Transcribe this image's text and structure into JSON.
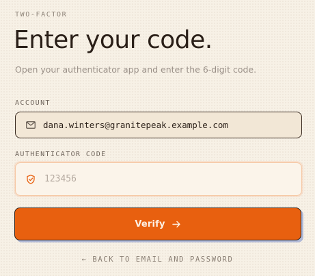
{
  "header": {
    "eyebrow": "TWO-FACTOR",
    "title": "Enter your code.",
    "subtitle": "Open your authenticator app and enter the 6-digit code."
  },
  "account": {
    "label": "ACCOUNT",
    "value": "dana.winters@granitepeak.example.com",
    "icon": "mail-icon"
  },
  "code": {
    "label": "AUTHENTICATOR CODE",
    "value": "",
    "placeholder": "123456",
    "icon": "shield-icon"
  },
  "verify": {
    "label": "Verify",
    "icon": "arrow-right-icon"
  },
  "back": {
    "label": "← BACK TO EMAIL AND PASSWORD"
  },
  "colors": {
    "accent": "#e8600f",
    "background": "#f7f1e6",
    "text": "#2a1f18"
  }
}
